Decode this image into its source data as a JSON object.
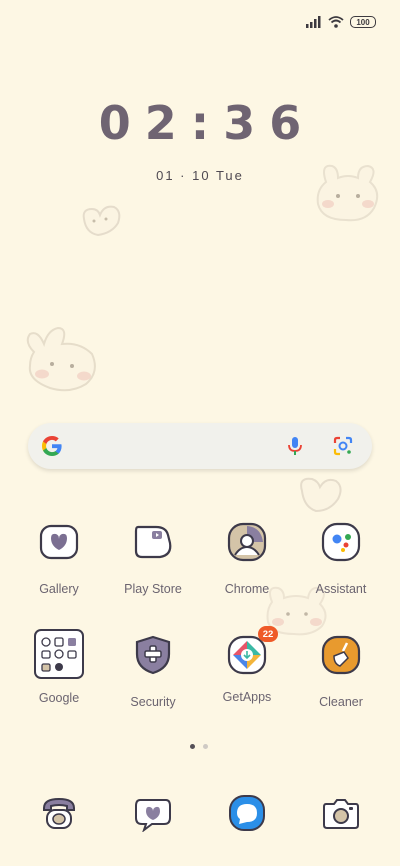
{
  "status": {
    "battery_level": "100",
    "icons": [
      "signal-icon",
      "wifi-icon",
      "battery-icon"
    ]
  },
  "lockscreen": {
    "time": "02:36",
    "date": "01 · 10  Tue"
  },
  "search": {
    "icons": [
      "google-logo-icon",
      "microphone-icon",
      "google-lens-icon"
    ]
  },
  "apps_row1": [
    {
      "label": "Gallery"
    },
    {
      "label": "Play Store"
    },
    {
      "label": "Chrome"
    },
    {
      "label": "Assistant"
    }
  ],
  "apps_row2": [
    {
      "label": "Google"
    },
    {
      "label": "Security"
    },
    {
      "label": "GetApps",
      "badge": "22"
    },
    {
      "label": "Cleaner"
    }
  ],
  "pages": {
    "count": 2,
    "active": 1
  },
  "dock": [
    "phone-icon",
    "messages-icon",
    "chat-bubble-icon",
    "camera-icon"
  ],
  "colors": {
    "background": "#fdf7e4",
    "icon_outline": "#3d3a4a",
    "icon_fill_purple": "#8a7fa0",
    "badge": "#ef5a28"
  }
}
